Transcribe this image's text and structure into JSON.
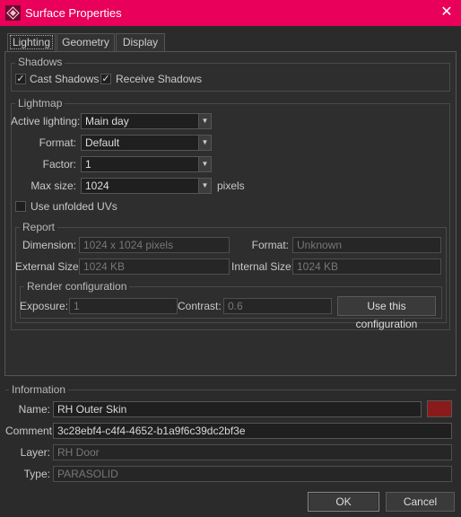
{
  "window": {
    "title": "Surface Properties",
    "accent_color": "#e8005a",
    "app_icon": "app-logo-icon",
    "close_icon": "close-icon"
  },
  "tabs": [
    {
      "label": "Lighting",
      "active": true
    },
    {
      "label": "Geometry",
      "active": false
    },
    {
      "label": "Display",
      "active": false
    }
  ],
  "shadows": {
    "title": "Shadows",
    "cast": {
      "label": "Cast Shadows",
      "checked": true
    },
    "receive": {
      "label": "Receive Shadows",
      "checked": true
    }
  },
  "lightmap": {
    "title": "Lightmap",
    "active_lighting": {
      "label": "Active lighting:",
      "value": "Main day"
    },
    "format": {
      "label": "Format:",
      "value": "Default"
    },
    "factor": {
      "label": "Factor:",
      "value": "1"
    },
    "max_size": {
      "label": "Max size:",
      "value": "1024",
      "unit": "pixels"
    },
    "unfolded_uvs": {
      "label": "Use unfolded UVs",
      "checked": false
    },
    "report": {
      "title": "Report",
      "dimension": {
        "label": "Dimension:",
        "value": "1024 x 1024 pixels"
      },
      "format": {
        "label": "Format:",
        "value": "Unknown"
      },
      "external_size": {
        "label": "External Size:",
        "value": "1024 KB"
      },
      "internal_size": {
        "label": "Internal Size:",
        "value": "1024 KB"
      },
      "render_config": {
        "title": "Render configuration",
        "exposure": {
          "label": "Exposure:",
          "value": "1"
        },
        "contrast": {
          "label": "Contrast:",
          "value": "0.6"
        },
        "button": "Use this configuration"
      }
    }
  },
  "information": {
    "title": "Information",
    "name": {
      "label": "Name:",
      "value": "RH Outer Skin",
      "color": "#8b1a1a"
    },
    "comment": {
      "label": "Comment:",
      "value": "3c28ebf4-c4f4-4652-b1a9f6c39dc2bf3e"
    },
    "layer": {
      "label": "Layer:",
      "value": "RH Door"
    },
    "type": {
      "label": "Type:",
      "value": "PARASOLID"
    }
  },
  "footer": {
    "ok": "OK",
    "cancel": "Cancel"
  }
}
